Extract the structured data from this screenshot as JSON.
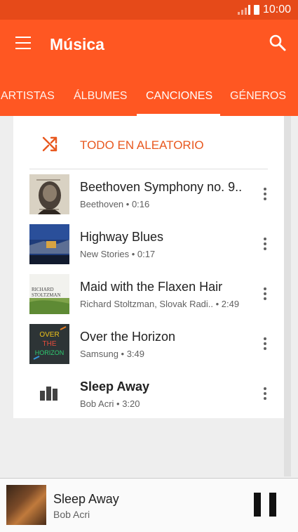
{
  "status": {
    "time": "10:00"
  },
  "appbar": {
    "title": "Música"
  },
  "tabs": [
    {
      "label": "ARTISTAS"
    },
    {
      "label": "ÁLBUMES"
    },
    {
      "label": "CANCIONES"
    },
    {
      "label": "GÉNEROS"
    }
  ],
  "active_tab": "CANCIONES",
  "shuffle": {
    "label": "TODO EN ALEATORIO",
    "color": "#e8581f"
  },
  "songs": [
    {
      "title": "Beethoven Symphony no. 9..",
      "subtitle": "Beethoven • 0:16",
      "art": "album-art-beethoven"
    },
    {
      "title": "Highway Blues",
      "subtitle": "New Stories • 0:17",
      "art": "album-art-highway"
    },
    {
      "title": "Maid with the Flaxen Hair",
      "subtitle": "Richard Stoltzman, Slovak Radi.. • 2:49",
      "art": "album-art-richard",
      "art_text_1": "RICHARD",
      "art_text_2": "STOLTZMAN"
    },
    {
      "title": "Over the Horizon",
      "subtitle": "Samsung • 3:49",
      "art": "album-art-horizon",
      "art_text_1": "OVER",
      "art_text_2": "THE",
      "art_text_3": "HORIZON"
    },
    {
      "title": "Sleep Away",
      "subtitle": "Bob Acri • 3:20",
      "art": "now-playing-icon",
      "playing": true
    }
  ],
  "player": {
    "title": "Sleep Away",
    "artist": "Bob Acri"
  },
  "colors": {
    "appbar": "#ff5722",
    "statusbar": "#e64a19",
    "accent": "#e8581f"
  }
}
